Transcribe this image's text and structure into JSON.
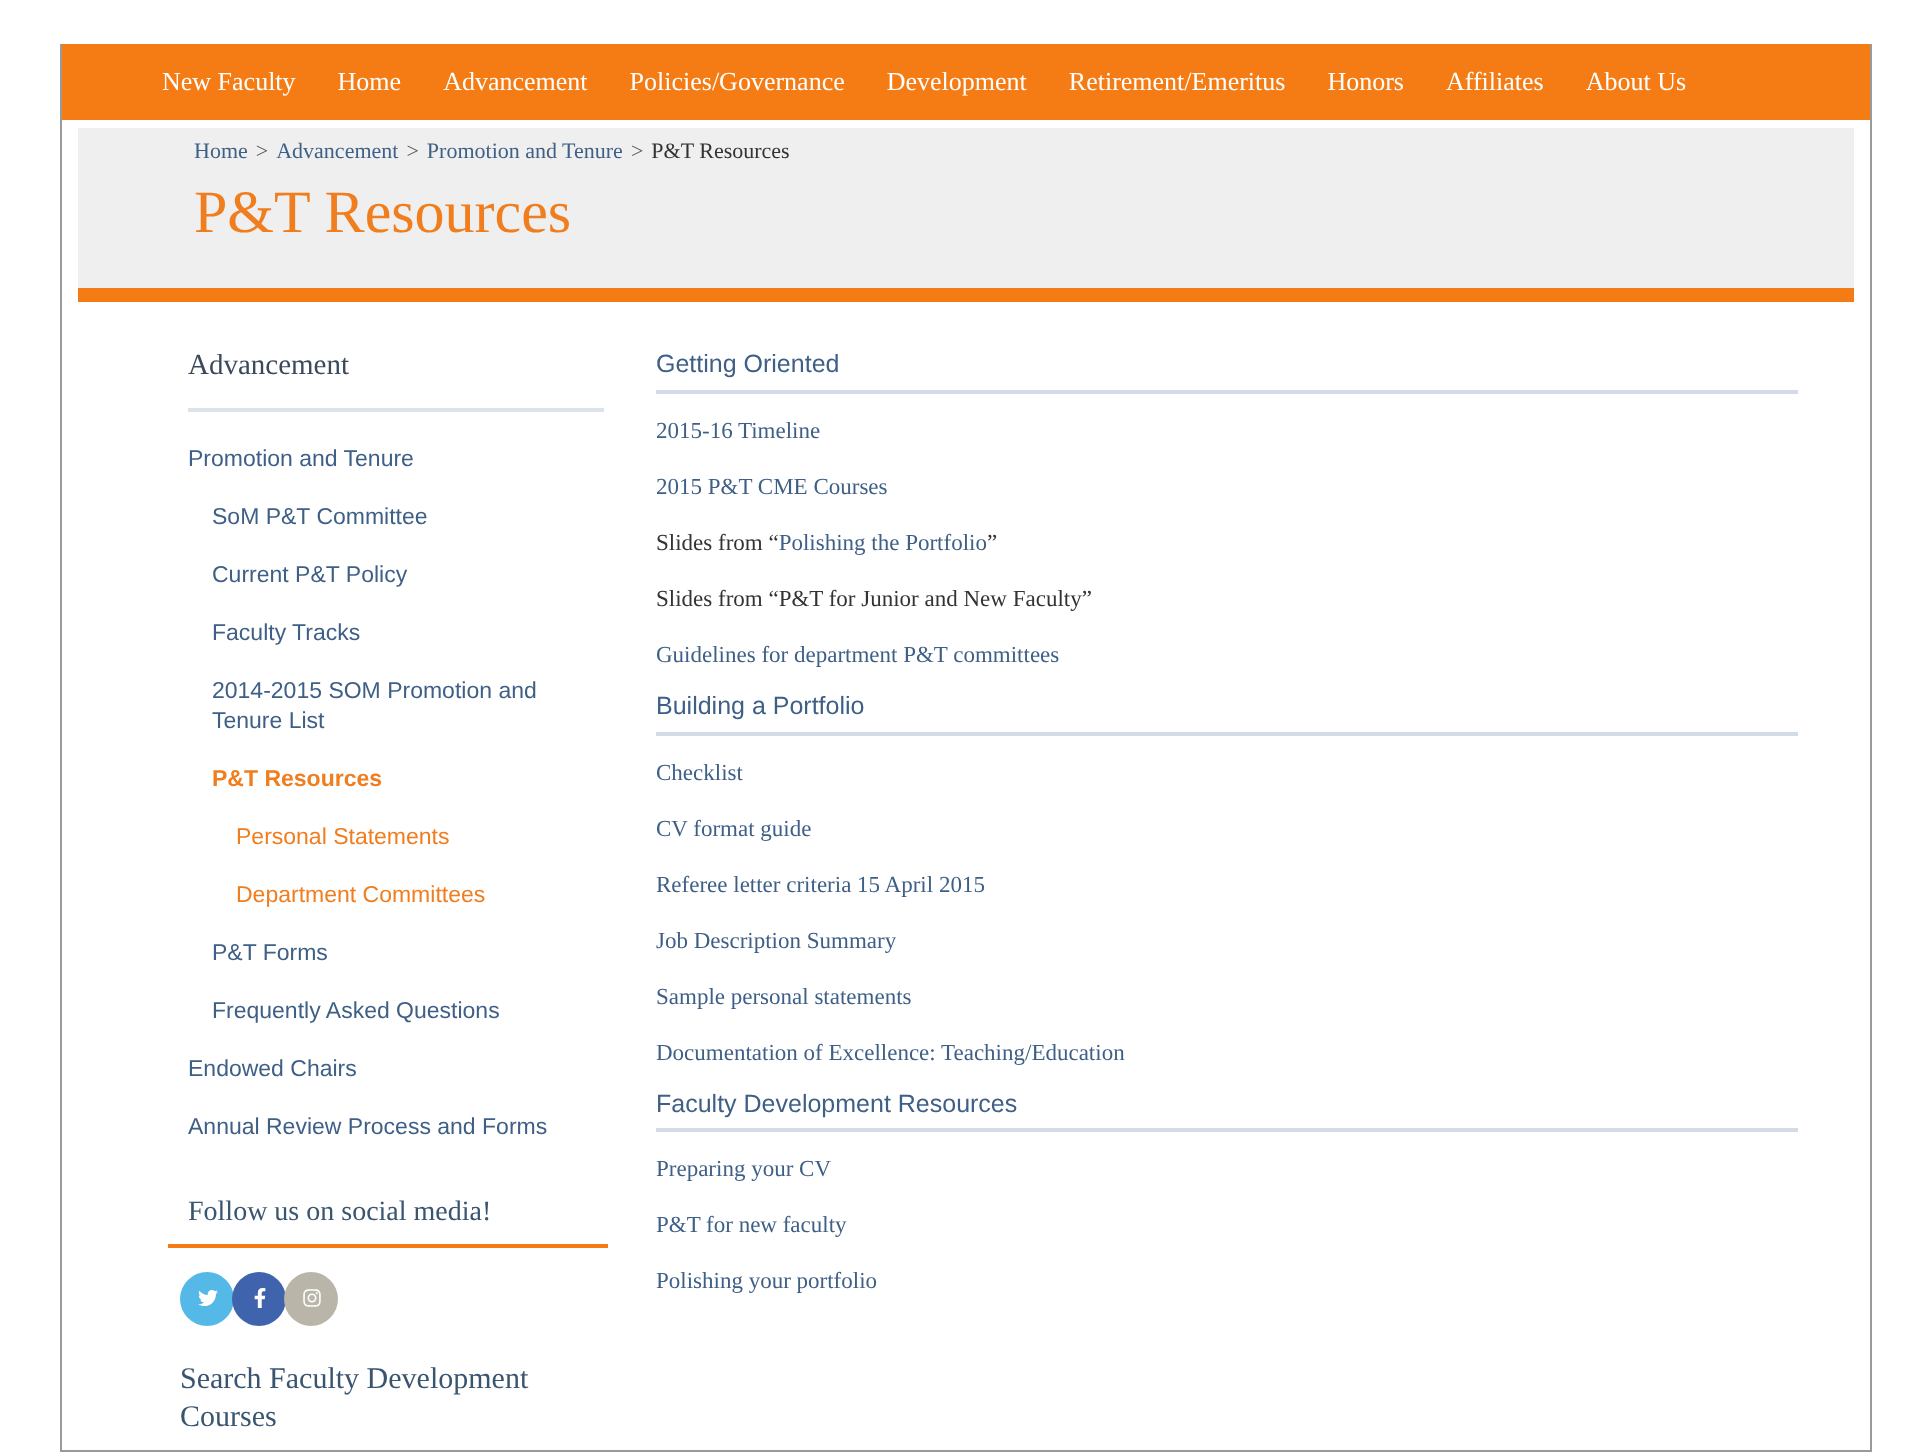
{
  "nav": [
    {
      "label": "New Faculty",
      "selected": false
    },
    {
      "label": "Home",
      "selected": false
    },
    {
      "label": "Advancement",
      "selected": false
    },
    {
      "label": "Policies/Governance",
      "selected": false
    },
    {
      "label": "Development",
      "selected": false
    },
    {
      "label": "Retirement/Emeritus",
      "selected": false
    },
    {
      "label": "Honors",
      "selected": false
    },
    {
      "label": "Affiliates",
      "selected": false
    },
    {
      "label": "About Us",
      "selected": false
    }
  ],
  "breadcrumb": {
    "links": [
      "Home",
      "Advancement",
      "Promotion and Tenure"
    ],
    "separator": ">",
    "current": "P&T Resources"
  },
  "page_title": "P&T Resources",
  "sidebar": {
    "title": "Advancement",
    "items": [
      {
        "label": "Promotion and Tenure",
        "selected": false,
        "children": [
          {
            "label": "SoM P&T Committee",
            "selected": false
          },
          {
            "label": "Current P&T Policy",
            "selected": false
          },
          {
            "label": "Faculty Tracks",
            "selected": false
          },
          {
            "label": "2014-2015 SOM Promotion and Tenure List",
            "selected": false
          },
          {
            "label": "P&T Resources",
            "selected": true,
            "children": [
              {
                "label": "Personal Statements",
                "selected": false
              },
              {
                "label": "Department Committees",
                "selected": false
              }
            ]
          },
          {
            "label": "P&T Forms",
            "selected": false
          },
          {
            "label": "Frequently Asked Questions",
            "selected": false
          }
        ]
      },
      {
        "label": "Endowed Chairs",
        "selected": false
      },
      {
        "label": "Annual Review Process and Forms",
        "selected": false
      }
    ],
    "social_title": "Follow us on social media!",
    "social": [
      {
        "kind": "twitter",
        "color": "#55b9e8"
      },
      {
        "kind": "facebook",
        "color": "#3f64ad"
      },
      {
        "kind": "instagram",
        "color": "#b9b5a8"
      }
    ],
    "search_title": "Search Faculty Development Courses"
  },
  "sections": [
    {
      "title": "Getting Oriented",
      "items": [
        {
          "kind": "link",
          "text": "2015-16 Timeline"
        },
        {
          "kind": "link",
          "text": "2015 P&T CME Courses"
        },
        {
          "kind": "mixed",
          "prefix": "Slides from “",
          "link": "Polishing the Portfolio",
          "suffix": "”"
        },
        {
          "kind": "plain",
          "text": "Slides from “P&T for Junior and New Faculty”"
        },
        {
          "kind": "link",
          "text": "Guidelines for department P&T committees"
        }
      ]
    },
    {
      "title": "Building a Portfolio",
      "items": [
        {
          "kind": "link",
          "text": "Checklist"
        },
        {
          "kind": "link",
          "text": "CV format guide"
        },
        {
          "kind": "link",
          "text": "Referee letter criteria 15 April 2015"
        },
        {
          "kind": "link",
          "text": "Job Description Summary"
        },
        {
          "kind": "link",
          "text": "Sample personal statements"
        },
        {
          "kind": "link",
          "text": "Documentation of Excellence: Teaching/Education"
        }
      ]
    },
    {
      "title": "Faculty Development Resources",
      "items": [
        {
          "kind": "link",
          "text": "Preparing your CV"
        },
        {
          "kind": "link",
          "text": "P&T for new faculty"
        },
        {
          "kind": "link",
          "text": "Polishing your portfolio"
        }
      ]
    }
  ]
}
